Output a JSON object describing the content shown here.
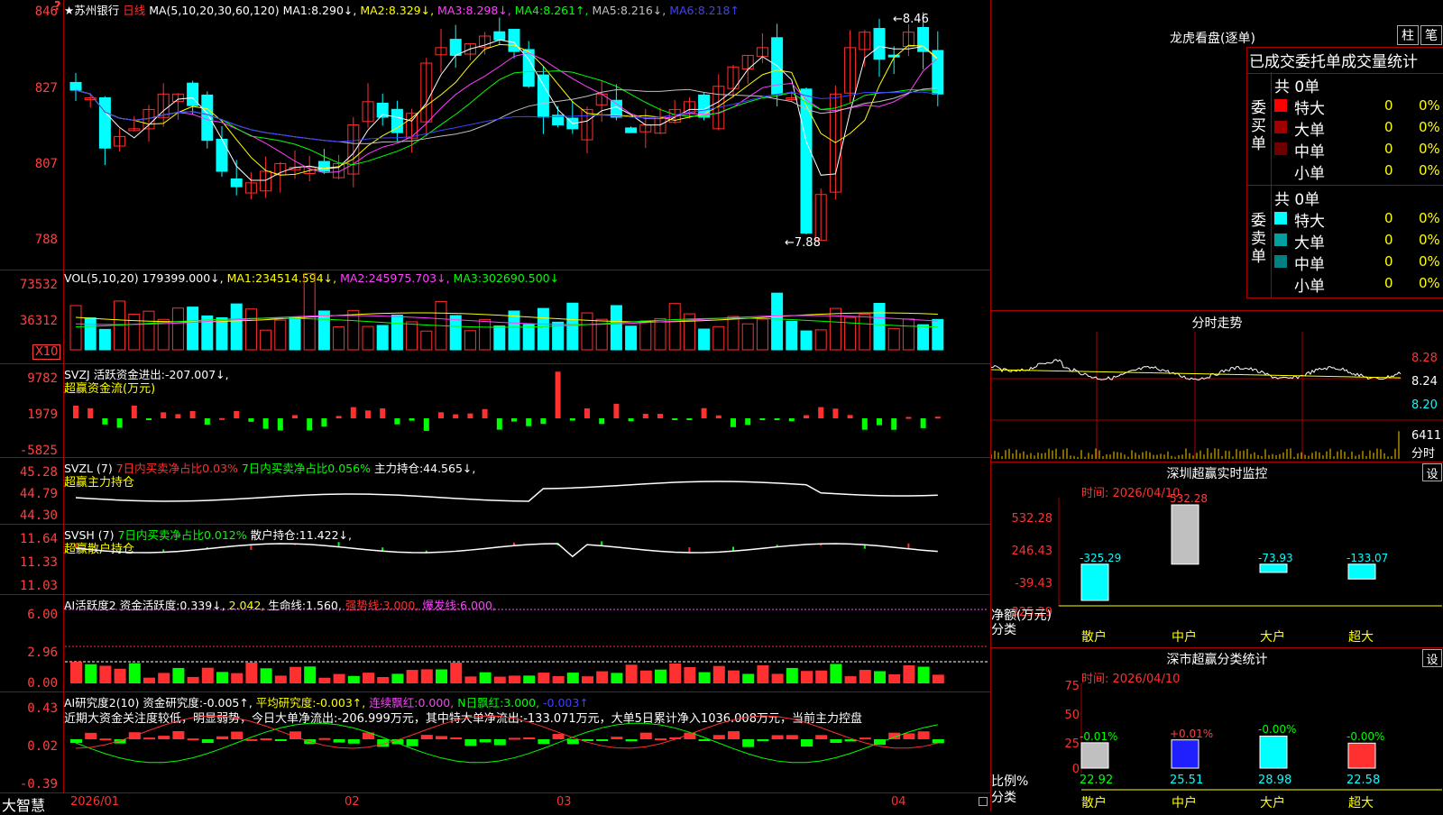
{
  "header": {
    "stock_name": "★苏州银行",
    "period": "日线",
    "ma_params": "MA(5,10,20,30,60,120)",
    "ma_values": [
      {
        "label": "MA1:",
        "value": "8.290↓,",
        "color": "#ffffff"
      },
      {
        "label": "MA2:",
        "value": "8.329↓,",
        "color": "#ffff00"
      },
      {
        "label": "MA3:",
        "value": "8.298↓,",
        "color": "#ff40ff"
      },
      {
        "label": "MA4:",
        "value": "8.261↑,",
        "color": "#00ff00"
      },
      {
        "label": "MA5:",
        "value": "8.216↓,",
        "color": "#c0c0c0"
      },
      {
        "label": "MA6:",
        "value": "8.218↑",
        "color": "#4040ff"
      }
    ],
    "question_mark": "?"
  },
  "price_panel": {
    "yticks": [
      "846",
      "827",
      "807",
      "788"
    ],
    "high_label": "8.46",
    "low_label": "7.88"
  },
  "vol_panel": {
    "params": "VOL(5,10,20)",
    "value": "179399.000↓,",
    "ma": [
      {
        "label": "MA1:",
        "value": "234514.594↓,",
        "color": "#ffff00"
      },
      {
        "label": "MA2:",
        "value": "245975.703↓,",
        "color": "#ff40ff"
      },
      {
        "label": "MA3:",
        "value": "302690.500↓",
        "color": "#00ff00"
      }
    ],
    "yticks": [
      "73532",
      "36312"
    ],
    "unit": "X10"
  },
  "svzj_panel": {
    "name": "SVZJ",
    "line1": "活跃资金进出:-207.007↓,",
    "line2": "超赢资金流(万元)",
    "yticks": [
      "9782",
      "1979",
      "-5825"
    ]
  },
  "svzl_panel": {
    "name": "SVZL (7)",
    "p1": "7日内买卖净占比0.03%",
    "p2": "7日内买卖净占比0.056%",
    "p3": "主力持仓:44.565↓,",
    "line2": "超赢主力持仓",
    "yticks": [
      "45.28",
      "44.79",
      "44.30"
    ]
  },
  "svsh_panel": {
    "name": "SVSH (7)",
    "p1": "7日内买卖净占比0.012%",
    "p2": "散户持仓:11.422↓,",
    "line2": "超赢散户持仓",
    "yticks": [
      "11.64",
      "11.33",
      "11.03"
    ]
  },
  "ai1_panel": {
    "name": "AI活跃度2",
    "p1": "资金活跃度:0.339↓,",
    "p2": "2.042,",
    "p3": "生命线:1.560,",
    "p4": "强势线:3.000,",
    "p5": "爆发线:6.000,",
    "yticks": [
      "6.00",
      "2.96",
      "0.00"
    ]
  },
  "ai2_panel": {
    "name": "AI研究度2(10)",
    "p1": "资金研究度:-0.005↑,",
    "p2": "平均研究度:-0.003↑,",
    "p3": "连续飘红:0.000,",
    "p4": "N日飘红:3.000,",
    "p5": "-0.003↑",
    "comment": "近期大资金关注度较低，明显弱势，今日大单净流出:-206.999万元，其中特大单净流出:-133.071万元，大单5日累计净入1036.008万元，当前主力控盘",
    "yticks": [
      "0.43",
      "0.02",
      "-0.39"
    ]
  },
  "footer": {
    "brand": "大智慧",
    "dates": [
      "2026/01",
      "02",
      "03",
      "04"
    ]
  },
  "longhu": {
    "title": "龙虎看盘(逐单)",
    "btn1": "柱",
    "btn2": "笔",
    "tabs": "已成交委托单成交量统计",
    "buy": {
      "side_label": "委买单",
      "total": "共 0单",
      "rows": [
        {
          "label": "特大",
          "count": "0",
          "pct": "0%",
          "color": "#ff0000"
        },
        {
          "label": "大单",
          "count": "0",
          "pct": "0%",
          "color": "#a00000"
        },
        {
          "label": "中单",
          "count": "0",
          "pct": "0%",
          "color": "#700000"
        },
        {
          "label": "小单",
          "count": "0",
          "pct": "0%",
          "color": "#000000"
        }
      ]
    },
    "sell": {
      "side_label": "委卖单",
      "total": "共 0单",
      "rows": [
        {
          "label": "特大",
          "count": "0",
          "pct": "0%",
          "color": "#00ffff"
        },
        {
          "label": "大单",
          "count": "0",
          "pct": "0%",
          "color": "#00a0a0"
        },
        {
          "label": "中单",
          "count": "0",
          "pct": "0%",
          "color": "#008080"
        },
        {
          "label": "小单",
          "count": "0",
          "pct": "0%",
          "color": "#000000"
        }
      ]
    }
  },
  "intraday": {
    "title": "分时走势",
    "yticks": [
      "8.28",
      "8.24",
      "8.20"
    ],
    "vol_label": "6411",
    "vol_unit": "分时"
  },
  "sz_monitor": {
    "title": "深圳超赢实时监控",
    "settings": "设",
    "time_label": "时间: 2026/04/10",
    "yticks": [
      "532.28",
      "246.43",
      "-39.43",
      "-325.29"
    ],
    "y_axis_label": "净额(万元)",
    "x_axis_label": "分类",
    "categories": [
      "散户",
      "中户",
      "大户",
      "超大"
    ],
    "values": [
      "-325.29",
      "532.28",
      "-73.93",
      "-133.07"
    ]
  },
  "sz_stats": {
    "title": "深市超赢分类统计",
    "settings": "设",
    "time_label": "时间: 2026/04/10",
    "yticks": [
      "75",
      "50",
      "25",
      "0"
    ],
    "y_axis_label": "比例%",
    "x_axis_label": "分类",
    "categories": [
      "散户",
      "中户",
      "大户",
      "超大"
    ],
    "changes": [
      "-0.01%",
      "+0.01%",
      "-0.00%",
      "-0.00%"
    ],
    "values": [
      "22.92",
      "25.51",
      "28.98",
      "22.58"
    ]
  },
  "chart_data": [
    {
      "type": "candlestick",
      "title": "苏州银行 日线",
      "ylim": [
        7.85,
        8.48
      ],
      "high": 8.46,
      "low": 7.88,
      "ma": {
        "MA1": 8.29,
        "MA2": 8.329,
        "MA3": 8.298,
        "MA4": 8.261,
        "MA5": 8.216,
        "MA6": 8.218
      }
    },
    {
      "type": "bar",
      "title": "深圳超赢实时监控",
      "categories": [
        "散户",
        "中户",
        "大户",
        "超大"
      ],
      "values": [
        -325.29,
        532.28,
        -73.93,
        -133.07
      ],
      "ylim": [
        -325.29,
        532.28
      ]
    },
    {
      "type": "bar",
      "title": "深市超赢分类统计",
      "categories": [
        "散户",
        "中户",
        "大户",
        "超大"
      ],
      "values": [
        22.92,
        25.51,
        28.98,
        22.58
      ],
      "ylim": [
        0,
        75
      ]
    }
  ]
}
